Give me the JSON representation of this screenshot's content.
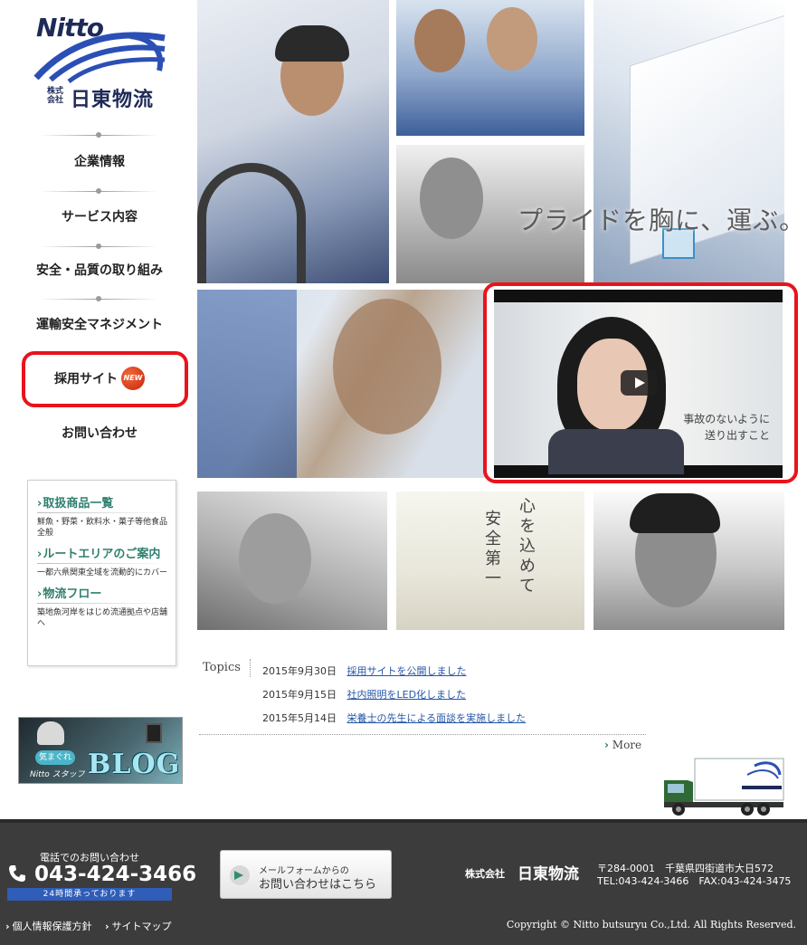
{
  "brand": {
    "logo_word": "Nitto",
    "corp_prefix": "株式会社",
    "corp_name": "日東物流"
  },
  "nav": {
    "items": [
      {
        "label": "企業情報"
      },
      {
        "label": "サービス内容"
      },
      {
        "label": "安全・品質の取り組み"
      },
      {
        "label": "運輸安全マネジメント"
      },
      {
        "label": "採用サイト",
        "badge": "NEW"
      },
      {
        "label": "お問い合わせ"
      }
    ]
  },
  "info": {
    "sections": [
      {
        "title": "取扱商品一覧",
        "desc": "鮮魚・野菜・飲料水・菓子等他食品全般"
      },
      {
        "title": "ルートエリアのご案内",
        "desc": "一都六県関東全域を流動的にカバー"
      },
      {
        "title": "物流フロー",
        "desc": "築地魚河岸をはじめ流通拠点や店舗へ"
      }
    ]
  },
  "blog": {
    "bubble": "気まぐれ",
    "staff": "Nitto スタッフ",
    "title": "BLOG"
  },
  "hero": {
    "tagline": "プライドを胸に、運ぶ。"
  },
  "video": {
    "caption_line1": "事故のないように",
    "caption_line2": "送り出すこと"
  },
  "topics": {
    "label": "Topics",
    "items": [
      {
        "date": "2015年9月30日",
        "title": "採用サイトを公開しました"
      },
      {
        "date": "2015年9月15日",
        "title": "社内照明をLED化しました"
      },
      {
        "date": "2015年5月14日",
        "title": "栄養士の先生による面談を実施しました"
      }
    ],
    "more_label": "More"
  },
  "footer": {
    "phone_label": "電話でのお問い合わせ",
    "phone_number": "043-424-3466",
    "phone_hours": "24時間承っております",
    "mail_sub": "メールフォームからの",
    "mail_main": "お問い合わせはこちら",
    "corp_prefix": "株式会社",
    "corp_name": "日東物流",
    "address": "〒284-0001　千葉県四街道市大日572",
    "tel_fax": "TEL:043-424-3466　FAX:043-424-3475",
    "links": [
      {
        "label": "個人情報保護方針"
      },
      {
        "label": "サイトマップ"
      }
    ],
    "copyright": "Copyright © Nitto butsuryu Co.,Ltd. All Rights Reserved."
  },
  "colors": {
    "highlight_red": "#e8141c",
    "accent_green": "#2f7f6d",
    "link_blue": "#2456a7",
    "footer_bg": "#3c3c3c",
    "hours_blue": "#2f5db8"
  }
}
